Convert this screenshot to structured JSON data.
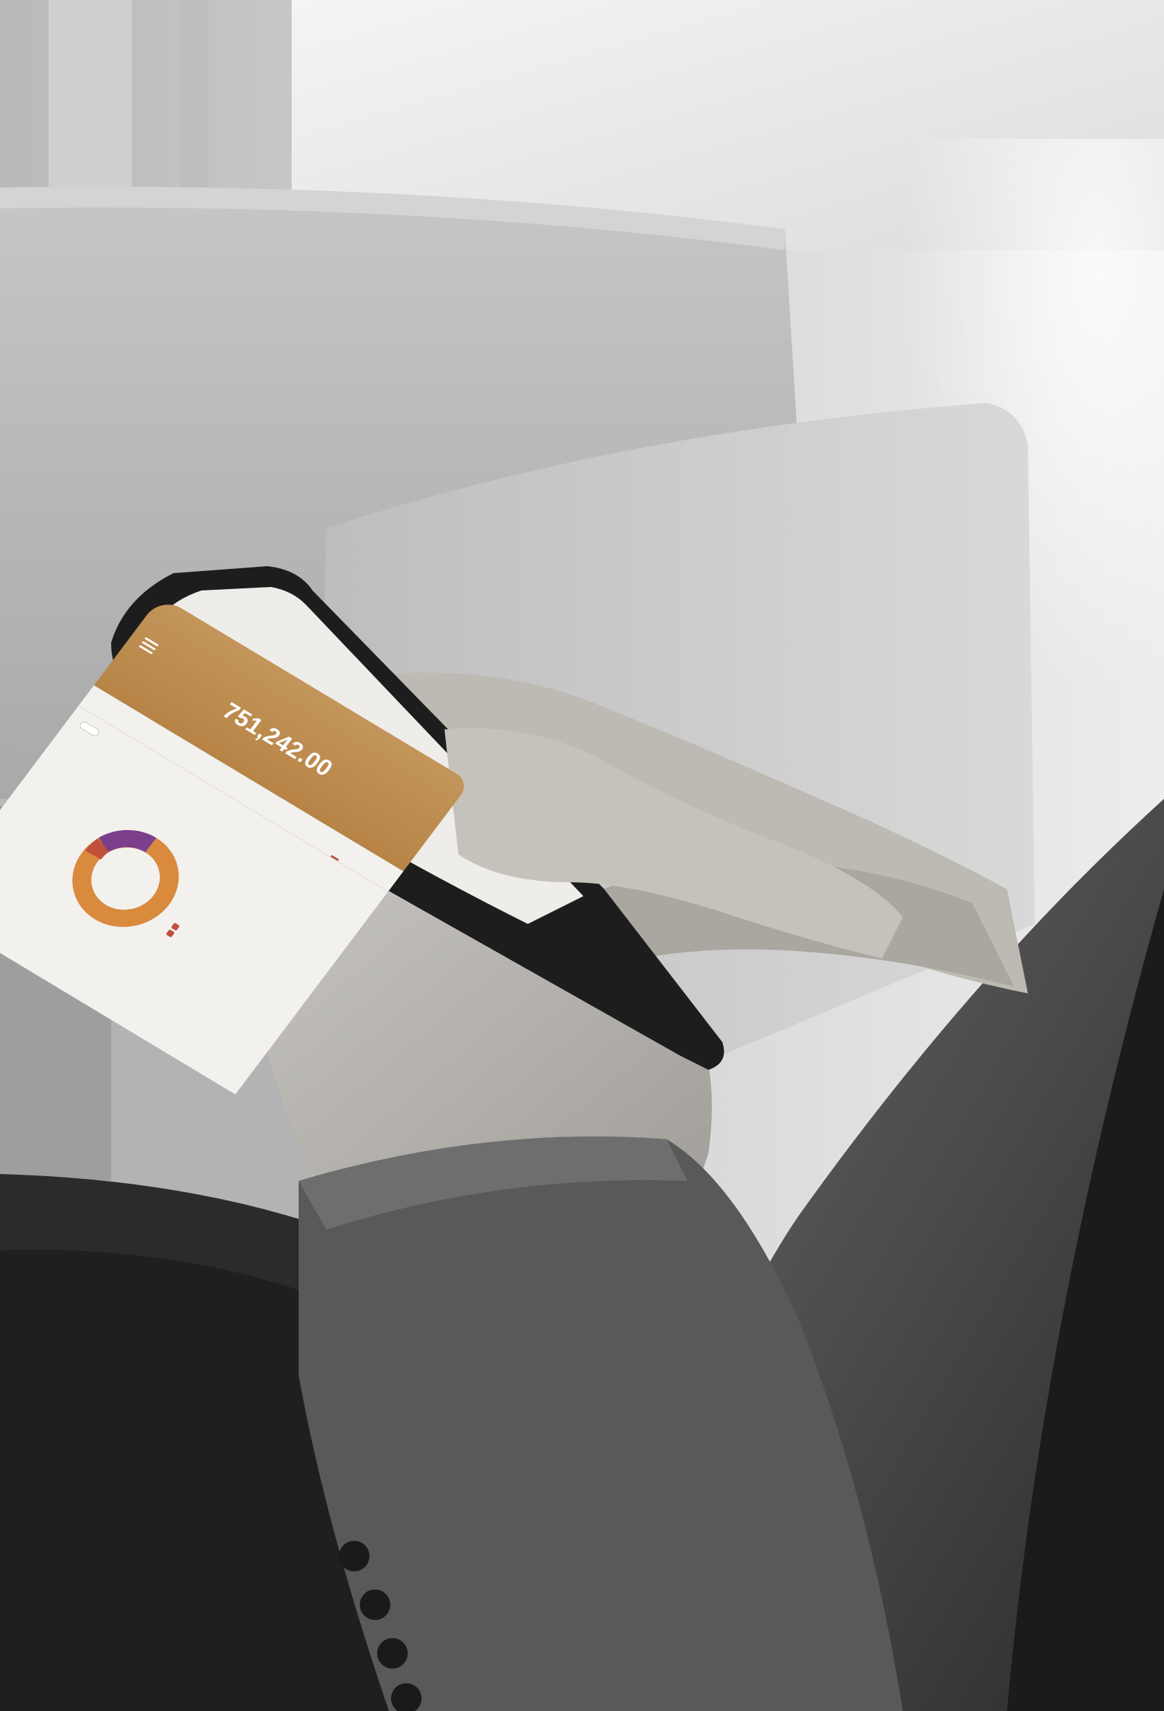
{
  "colors": {
    "accent_gold": "#c3955a",
    "accent_red": "#c0503c",
    "accent_purple": "#7b3f8c",
    "donut_orange": "#d98a3d"
  },
  "phone": {
    "balance": "751,242.00",
    "header_line1": "",
    "header_line2": "",
    "balance_note": "",
    "tabs": [
      "",
      "",
      ""
    ],
    "chip": "",
    "section_title": "",
    "legend": [
      "",
      ""
    ]
  },
  "icons": [
    "menu-icon"
  ]
}
